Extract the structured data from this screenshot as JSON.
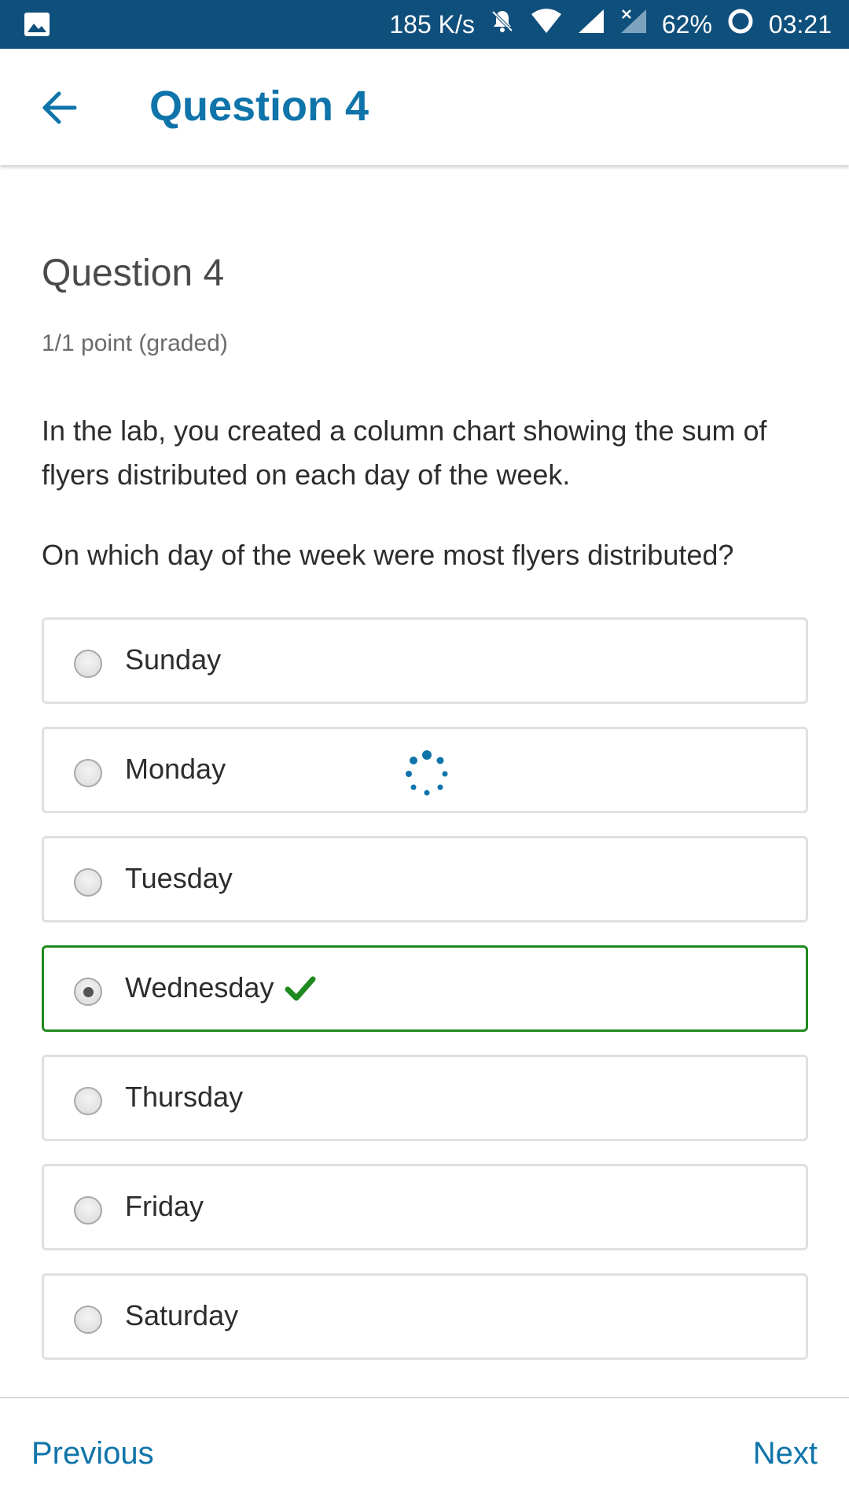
{
  "status_bar": {
    "left_icon": "image-icon",
    "network_speed": "185 K/s",
    "battery": "62%",
    "time": "03:21"
  },
  "app_bar": {
    "title": "Question 4",
    "back_icon": "arrow-left-icon"
  },
  "question": {
    "heading": "Question 4",
    "points": "1/1 point (graded)",
    "text": "In the lab, you created a column chart showing the sum of flyers distributed on each day of the week.",
    "prompt": "On which day of the week were most flyers distributed?"
  },
  "options": [
    {
      "label": "Sunday",
      "selected": false,
      "correct": false
    },
    {
      "label": "Monday",
      "selected": false,
      "correct": false
    },
    {
      "label": "Tuesday",
      "selected": false,
      "correct": false
    },
    {
      "label": "Wednesday",
      "selected": true,
      "correct": true
    },
    {
      "label": "Thursday",
      "selected": false,
      "correct": false
    },
    {
      "label": "Friday",
      "selected": false,
      "correct": false
    },
    {
      "label": "Saturday",
      "selected": false,
      "correct": false
    }
  ],
  "footer": {
    "previous_label": "Previous",
    "next_label": "Next"
  },
  "colors": {
    "status_bar": "#0f4f7c",
    "accent": "#0f74aa",
    "correct": "#1f8a1f"
  }
}
